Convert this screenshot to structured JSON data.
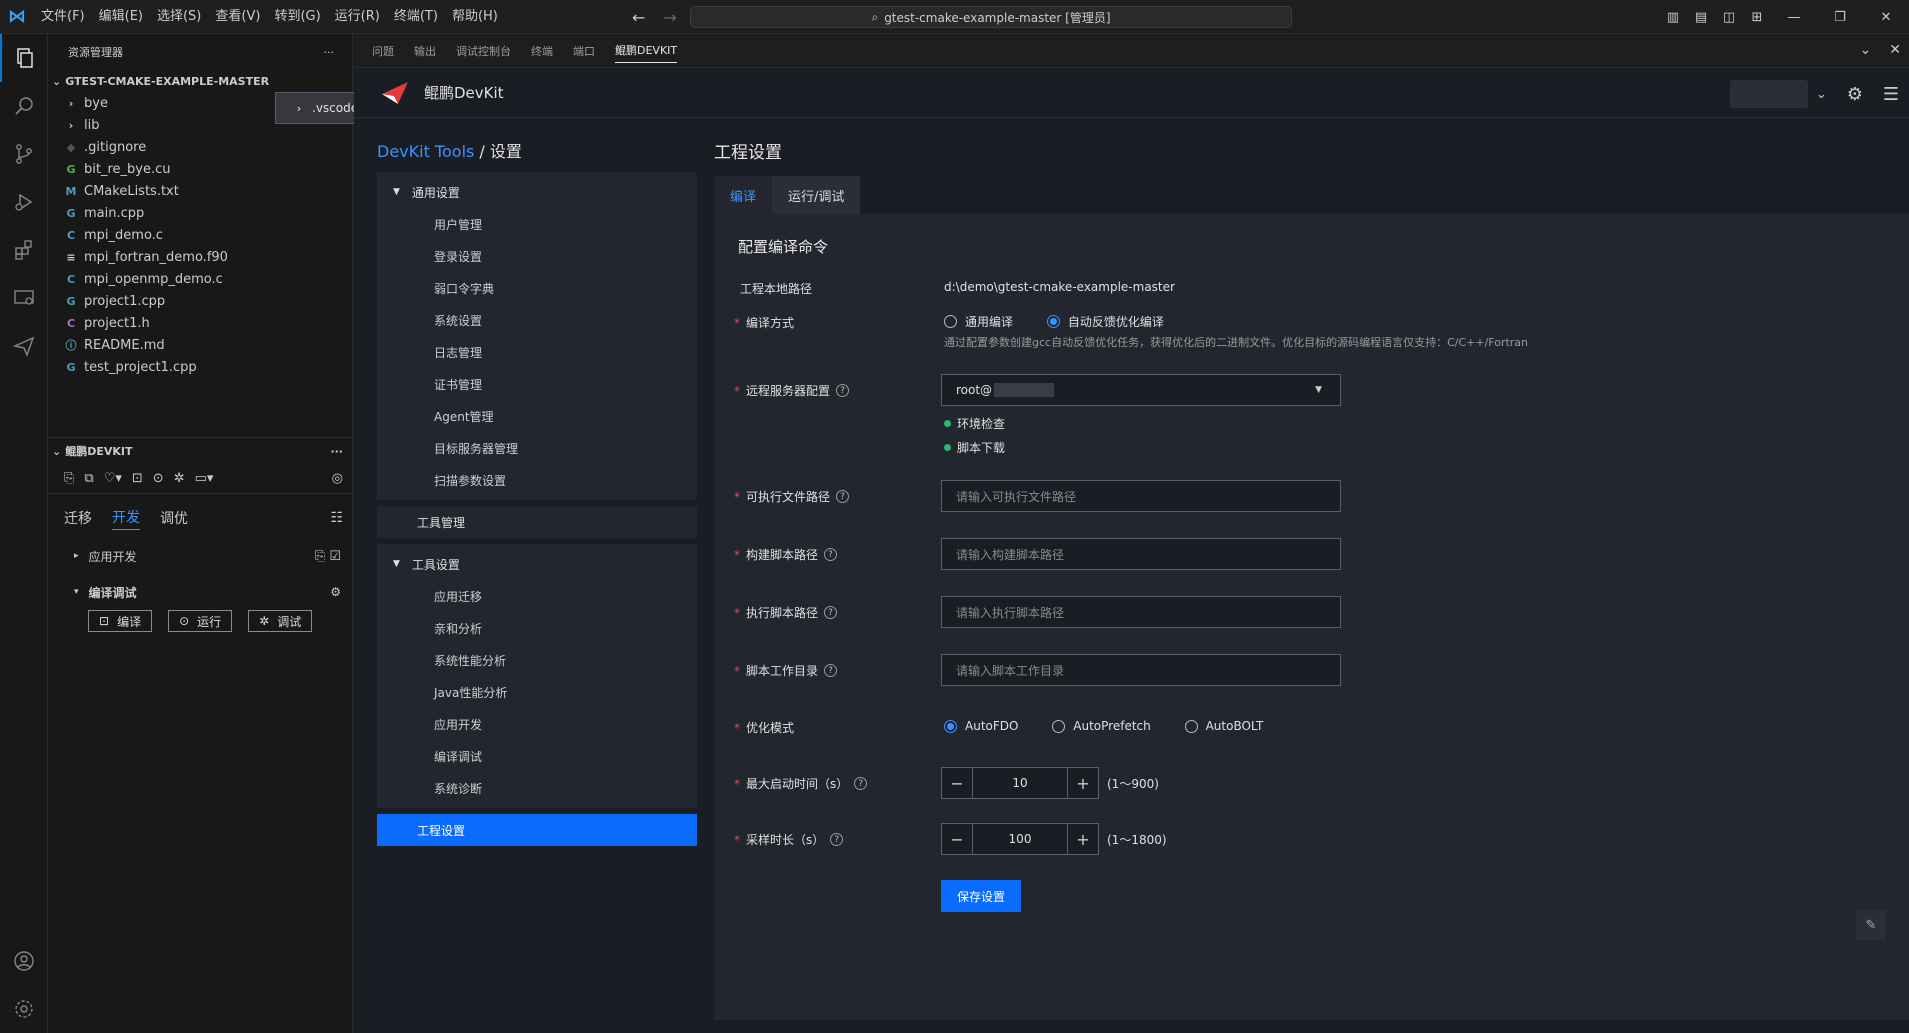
{
  "menu": [
    "文件(F)",
    "编辑(E)",
    "选择(S)",
    "查看(V)",
    "转到(G)",
    "运行(R)",
    "终端(T)",
    "帮助(H)"
  ],
  "search": {
    "text": "gtest-cmake-example-master [管理员]"
  },
  "explorer": {
    "title": "资源管理器",
    "root": "GTEST-CMAKE-EXAMPLE-MASTER",
    "items": [
      {
        "name": ".vscode",
        "icon": "›",
        "color": "#ccc"
      },
      {
        "name": "bye",
        "icon": "›",
        "color": "#ccc"
      },
      {
        "name": "lib",
        "icon": "›",
        "color": "#ccc"
      },
      {
        "name": ".gitignore",
        "icon": "◆",
        "color": "#555"
      },
      {
        "name": "bit_re_bye.cu",
        "icon": "G",
        "color": "#4caf50"
      },
      {
        "name": "CMakeLists.txt",
        "icon": "M",
        "color": "#519aba"
      },
      {
        "name": "main.cpp",
        "icon": "G",
        "color": "#519aba"
      },
      {
        "name": "mpi_demo.c",
        "icon": "C",
        "color": "#519aba"
      },
      {
        "name": "mpi_fortran_demo.f90",
        "icon": "≡",
        "color": "#ccc"
      },
      {
        "name": "mpi_openmp_demo.c",
        "icon": "C",
        "color": "#519aba"
      },
      {
        "name": "project1.cpp",
        "icon": "G",
        "color": "#519aba"
      },
      {
        "name": "project1.h",
        "icon": "C",
        "color": "#a074c4"
      },
      {
        "name": "README.md",
        "icon": "ⓘ",
        "color": "#519aba"
      },
      {
        "name": "test_project1.cpp",
        "icon": "G",
        "color": "#519aba"
      }
    ]
  },
  "devkit_side": {
    "title": "鲲鹏DEVKIT",
    "tabs": [
      "迁移",
      "开发",
      "调优"
    ],
    "rows": [
      "应用开发",
      "编译调试"
    ],
    "buttons": [
      "编译",
      "运行",
      "调试"
    ]
  },
  "panel_tabs": [
    "问题",
    "输出",
    "调试控制台",
    "终端",
    "端口",
    "鲲鹏DEVKIT"
  ],
  "brand": "鲲鹏DevKit",
  "breadcrumb": {
    "link": "DevKit Tools",
    "sep": " / ",
    "current": "设置"
  },
  "nav": {
    "general": {
      "title": "通用设置",
      "items": [
        "用户管理",
        "登录设置",
        "弱口令字典",
        "系统设置",
        "日志管理",
        "证书管理",
        "Agent管理",
        "目标服务器管理",
        "扫描参数设置"
      ]
    },
    "tool_manage": "工具管理",
    "tool_settings": {
      "title": "工具设置",
      "items": [
        "应用迁移",
        "亲和分析",
        "系统性能分析",
        "Java性能分析",
        "应用开发",
        "编译调试",
        "系统诊断"
      ]
    },
    "project": "工程设置"
  },
  "main": {
    "title": "工程设置",
    "tabs": [
      "编译",
      "运行/调试"
    ],
    "subtitle": "配置编译命令",
    "path_label": "工程本地路径",
    "path_value": "d:\\demo\\gtest-cmake-example-master",
    "compile_label": "编译方式",
    "compile_opts": [
      "通用编译",
      "自动反馈优化编译"
    ],
    "compile_hint": "通过配置参数创建gcc自动反馈优化任务，获得优化后的二进制文件。优化目标的源码编程语言仅支持：C/C++/Fortran",
    "remote_label": "远程服务器配置",
    "remote_value": "root@",
    "env_check": "环境检查",
    "script_dl": "脚本下载",
    "exec_label": "可执行文件路径",
    "exec_ph": "请输入可执行文件路径",
    "build_label": "构建脚本路径",
    "build_ph": "请输入构建脚本路径",
    "run_label": "执行脚本路径",
    "run_ph": "请输入执行脚本路径",
    "workdir_label": "脚本工作目录",
    "workdir_ph": "请输入脚本工作目录",
    "opt_label": "优化模式",
    "opt_opts": [
      "AutoFDO",
      "AutoPrefetch",
      "AutoBOLT"
    ],
    "maxstart_label": "最大启动时间（s）",
    "maxstart_value": "10",
    "maxstart_range": "(1～900)",
    "sample_label": "采样时长（s）",
    "sample_value": "100",
    "sample_range": "(1～1800)",
    "save": "保存设置"
  }
}
